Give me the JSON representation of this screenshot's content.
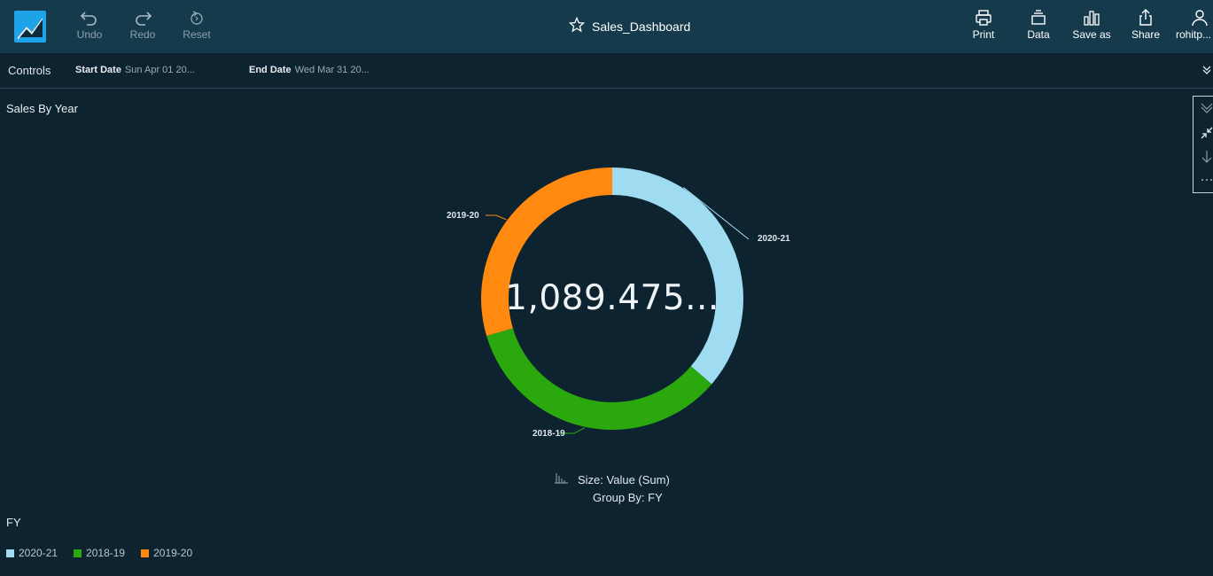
{
  "toolbar": {
    "undo": "Undo",
    "redo": "Redo",
    "reset": "Reset",
    "title": "Sales_Dashboard",
    "print": "Print",
    "data": "Data",
    "save_as": "Save as",
    "share": "Share",
    "user": "rohitp..."
  },
  "controls": {
    "label": "Controls",
    "start_label": "Start Date",
    "start_value": "Sun Apr 01 20...",
    "end_label": "End Date",
    "end_value": "Wed Mar 31 20..."
  },
  "visual": {
    "title": "Sales By Year",
    "center_value": "1,089.475...",
    "size_text": "Size: Value (Sum)",
    "group_text": "Group By: FY",
    "legend_title": "FY"
  },
  "chart_data": {
    "type": "pie",
    "title": "Sales By Year",
    "categories": [
      "2020-21",
      "2018-19",
      "2019-20"
    ],
    "values": [
      0.363,
      0.341,
      0.296
    ],
    "colors": [
      "#9fdcf2",
      "#2ca80f",
      "#ff8a0f"
    ],
    "center_total": "1,089.475...",
    "legend": [
      "2020-21",
      "2018-19",
      "2019-20"
    ],
    "legend_title": "FY",
    "legend_position": "bottom-left"
  }
}
